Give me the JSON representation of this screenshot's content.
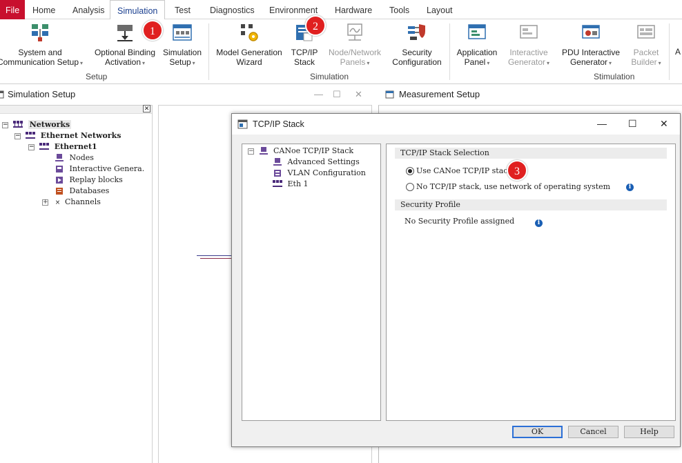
{
  "menu": {
    "items": [
      {
        "label": "File"
      },
      {
        "label": "Home"
      },
      {
        "label": "Analysis"
      },
      {
        "label": "Simulation"
      },
      {
        "label": "Test"
      },
      {
        "label": "Diagnostics"
      },
      {
        "label": "Environment"
      },
      {
        "label": "Hardware"
      },
      {
        "label": "Tools"
      },
      {
        "label": "Layout"
      }
    ],
    "active": "Simulation"
  },
  "ribbon": {
    "setup_group": {
      "label": "Setup",
      "buttons": [
        {
          "line1": "System and",
          "line2": "Communication Setup",
          "caret": "▾"
        },
        {
          "line1": "Optional Binding",
          "line2": "Activation",
          "caret": "▾"
        },
        {
          "line1": "Simulation",
          "line2": "Setup",
          "caret": "▾"
        }
      ]
    },
    "simulation_group": {
      "label": "Simulation",
      "buttons": [
        {
          "line1": "Model Generation",
          "line2": "Wizard"
        },
        {
          "line1": "TCP/IP",
          "line2": "Stack"
        },
        {
          "line1": "Node/Network",
          "line2": "Panels",
          "caret": "▾"
        },
        {
          "line1": "Security",
          "line2": "Configuration"
        }
      ]
    },
    "stimulation_group": {
      "label": "Stimulation",
      "buttons": [
        {
          "line1": "Application",
          "line2": "Panel",
          "caret": "▾"
        },
        {
          "line1": "Interactive",
          "line2": "Generator",
          "caret": "▾"
        },
        {
          "line1": "PDU Interactive",
          "line2": "Generator",
          "caret": "▾"
        },
        {
          "line1": "Packet",
          "line2": "Builder",
          "caret": "▾"
        }
      ]
    },
    "overflow_label": "A"
  },
  "badges": [
    "1",
    "2",
    "3"
  ],
  "sim_pane": {
    "title": "Simulation Setup",
    "close_glyph": "✕",
    "tree": [
      {
        "label": "Networks"
      },
      {
        "label": "Ethernet Networks"
      },
      {
        "label": "Ethernet1"
      },
      {
        "label": "Nodes"
      },
      {
        "label": "Interactive Genera."
      },
      {
        "label": "Replay blocks"
      },
      {
        "label": "Databases"
      },
      {
        "label": "Channels"
      }
    ]
  },
  "meas_pane": {
    "title": "Measurement Setup"
  },
  "dialog": {
    "title": "TCP/IP Stack",
    "tree": [
      {
        "label": "CANoe TCP/IP Stack"
      },
      {
        "label": "Advanced Settings"
      },
      {
        "label": "VLAN Configuration"
      },
      {
        "label": "Eth 1"
      }
    ],
    "stack_section": "TCP/IP Stack Selection",
    "radio_use": "Use CANoe TCP/IP stack",
    "radio_none": "No TCP/IP stack, use network of operating system",
    "security_section": "Security Profile",
    "security_value": "No Security Profile assigned",
    "buttons": {
      "ok": "OK",
      "cancel": "Cancel",
      "help": "Help"
    }
  },
  "colors": {
    "file_menu": "#c8102e",
    "badge": "#e02020",
    "info": "#1a5fb4",
    "default_button": "#2b6fd6"
  }
}
